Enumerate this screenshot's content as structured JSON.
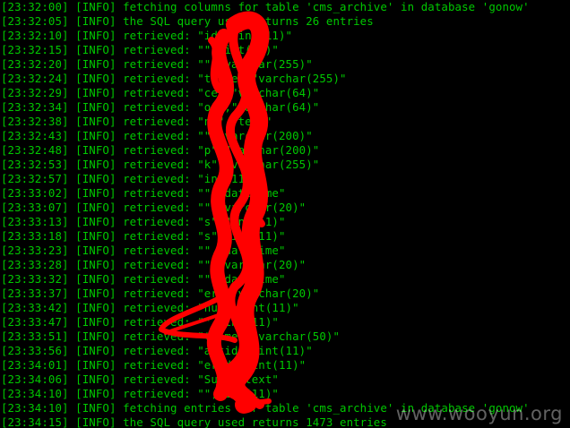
{
  "colors": {
    "background": "#000000",
    "text": "#00c800",
    "scribble": "#ff0000",
    "watermark": "rgba(255,255,255,0.38)"
  },
  "lines": [
    {
      "ts": "[23:32:00]",
      "level": "[INFO]",
      "msg": "fetching columns for table 'cms_archive' in database 'gonow'"
    },
    {
      "ts": "[23:32:05]",
      "level": "[INFO]",
      "msg": "the SQL query used returns 26 entries"
    },
    {
      "ts": "[23:32:10]",
      "level": "[INFO]",
      "msg": "retrieved: \"id\",\"int(11)\""
    },
    {
      "ts": "[23:32:15]",
      "level": "[INFO]",
      "msg": "retrieved: \"\",\"int(11)\""
    },
    {
      "ts": "[23:32:20]",
      "level": "[INFO]",
      "msg": "retrieved: \"\",\"varchar(255)\""
    },
    {
      "ts": "[23:32:24]",
      "level": "[INFO]",
      "msg": "retrieved: \"title\",\"varchar(255)\""
    },
    {
      "ts": "[23:32:29]",
      "level": "[INFO]",
      "msg": "retrieved: \"ce\",\"varchar(64)\""
    },
    {
      "ts": "[23:32:34]",
      "level": "[INFO]",
      "msg": "retrieved: \"or\",\"varchar(64)\""
    },
    {
      "ts": "[23:32:38]",
      "level": "[INFO]",
      "msg": "retrieved: \"nt\",\"text\""
    },
    {
      "ts": "[23:32:43]",
      "level": "[INFO]",
      "msg": "retrieved: \"\",\"varchar(200)\""
    },
    {
      "ts": "[23:32:48]",
      "level": "[INFO]",
      "msg": "retrieved: \"p\",\"varchar(200)\""
    },
    {
      "ts": "[23:32:53]",
      "level": "[INFO]",
      "msg": "retrieved: \"k\",\"varchar(255)\""
    },
    {
      "ts": "[23:32:57]",
      "level": "[INFO]",
      "msg": "retrieved: \"int(11)\""
    },
    {
      "ts": "[23:33:02]",
      "level": "[INFO]",
      "msg": "retrieved: \"\",\"datetime\""
    },
    {
      "ts": "[23:33:07]",
      "level": "[INFO]",
      "msg": "retrieved: \"\",\"varchar(20)\""
    },
    {
      "ts": "[23:33:13]",
      "level": "[INFO]",
      "msg": "retrieved: \"s\",\"int(11)\""
    },
    {
      "ts": "[23:33:18]",
      "level": "[INFO]",
      "msg": "retrieved: \"s\",\"int(11)\""
    },
    {
      "ts": "[23:33:23]",
      "level": "[INFO]",
      "msg": "retrieved: \"\",\"datetime\""
    },
    {
      "ts": "[23:33:28]",
      "level": "[INFO]",
      "msg": "retrieved: \"\",\"varchar(20)\""
    },
    {
      "ts": "[23:33:32]",
      "level": "[INFO]",
      "msg": "retrieved: \"\",\"datetime\""
    },
    {
      "ts": "[23:33:37]",
      "level": "[INFO]",
      "msg": "retrieved: \"er\",\"varchar(20)\""
    },
    {
      "ts": "[23:33:42]",
      "level": "[INFO]",
      "msg": "retrieved: \"num\",\"int(11)\""
    },
    {
      "ts": "[23:33:47]",
      "level": "[INFO]",
      "msg": "retrieved: \"\",\"int(11)\""
    },
    {
      "ts": "[23:33:51]",
      "level": "[INFO]",
      "msg": "retrieved: \"tname\",\"varchar(50)\""
    },
    {
      "ts": "[23:33:56]",
      "level": "[INFO]",
      "msg": "retrieved: \"artid\",\"int(11)\""
    },
    {
      "ts": "[23:34:01]",
      "level": "[INFO]",
      "msg": "retrieved: \"erid\",\"int(11)\""
    },
    {
      "ts": "[23:34:06]",
      "level": "[INFO]",
      "msg": "retrieved: \"Sum\",\"text\""
    },
    {
      "ts": "[23:34:10]",
      "level": "[INFO]",
      "msg": "retrieved: \"\",\"int(11)\""
    },
    {
      "ts": "[23:34:10]",
      "level": "[INFO]",
      "msg": "fetching entries for table 'cms_archive' in database 'gonow'"
    },
    {
      "ts": "[23:34:15]",
      "level": "[INFO]",
      "msg": "the SQL query used returns 1473 entries"
    }
  ],
  "watermark": "www.wooyun.org"
}
